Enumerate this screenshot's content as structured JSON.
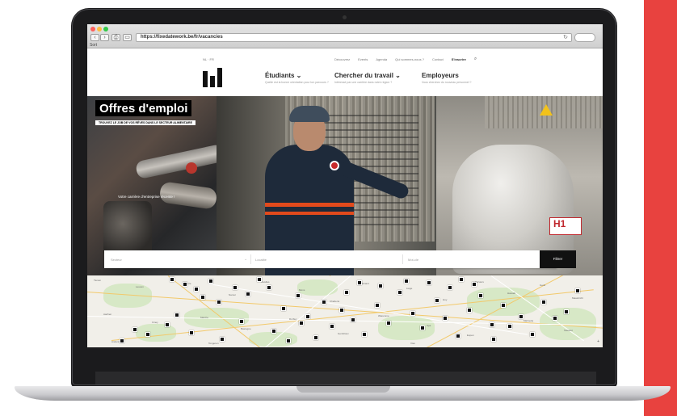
{
  "browser": {
    "url": "https://fixedatework.be/fr/vacancies",
    "bookmarks": "Sort"
  },
  "site": {
    "lang": "NL · FR",
    "utility_links": [
      "Découvrez",
      "Events",
      "Agenda",
      "Qui sommes-nous ?",
      "Contact",
      "S'inscrire"
    ],
    "nav": [
      {
        "label": "Étudiants ⌄",
        "sub": "Quelle est la bonne orientation pour ton parcours ?"
      },
      {
        "label": "Chercher du travail ⌄",
        "sub": "Intéressé par une carrière dans notre région ?"
      },
      {
        "label": "Employeurs",
        "sub": "Vous cherchez du nouveau personnel ?"
      }
    ]
  },
  "hero": {
    "title": "Offres d'emploi",
    "subtitle": "TROUVEZ LE JOB DE VOS RÊVES DANS LE SECTEUR ALIMENTAIRE",
    "note": "Votre carrière d'entreprise récente !",
    "tank_label": "H1"
  },
  "search": {
    "field1": "Secteur",
    "field2": "Localité",
    "field3": "Mot-clé",
    "button": "Filtrer"
  },
  "map": {
    "towns": [
      "Tienen",
      "Leuven",
      "Wavre",
      "Namur",
      "Nivelles",
      "Mons",
      "Charleroi",
      "Dinant",
      "Liège",
      "Huy",
      "Verviers",
      "Hasselt",
      "Genk",
      "Maastricht",
      "Aachen",
      "Ciney",
      "Marche",
      "Bastogne",
      "Durbuy",
      "Gembloux",
      "Waremme",
      "Spa",
      "Eupen",
      "Malmedy",
      "Stavelot",
      "Andenne",
      "Tongeren",
      "Visé"
    ],
    "zoom": "+"
  },
  "colors": {
    "accent_red": "#e8423f",
    "title_bg": "#000000",
    "button_bg": "#111111"
  }
}
